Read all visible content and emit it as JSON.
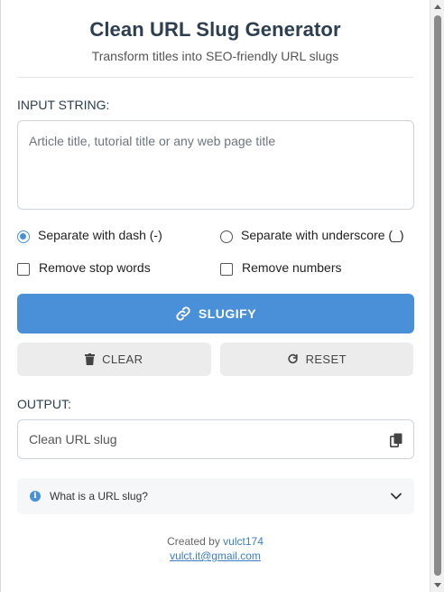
{
  "header": {
    "title": "Clean URL Slug Generator",
    "subtitle": "Transform titles into SEO-friendly URL slugs"
  },
  "input": {
    "label": "INPUT STRING:",
    "placeholder": "Article title, tutorial title or any web page title",
    "value": ""
  },
  "options": {
    "separator_dash": {
      "label": "Separate with dash (-)",
      "checked": true
    },
    "separator_underscore": {
      "label": "Separate with underscore (_)",
      "checked": false
    },
    "remove_stop_words": {
      "label": "Remove stop words",
      "checked": false
    },
    "remove_numbers": {
      "label": "Remove numbers",
      "checked": false
    }
  },
  "buttons": {
    "slugify": {
      "label": "SLUGIFY",
      "icon": "link-icon"
    },
    "clear": {
      "label": "CLEAR",
      "icon": "trash-icon"
    },
    "reset": {
      "label": "RESET",
      "icon": "redo-icon"
    }
  },
  "output": {
    "label": "OUTPUT:",
    "placeholder": "Clean URL slug",
    "copy_icon": "copy-icon"
  },
  "faq": {
    "question": "What is a URL slug?",
    "icon": "info-icon",
    "toggle_icon": "chevron-down-icon"
  },
  "footer": {
    "created_by": "Created by",
    "author": "vulct174",
    "email": "vulct.it@gmail.com"
  },
  "colors": {
    "accent": "#4a90d9",
    "title": "#2c3e50",
    "secondary_button": "#ececec"
  }
}
